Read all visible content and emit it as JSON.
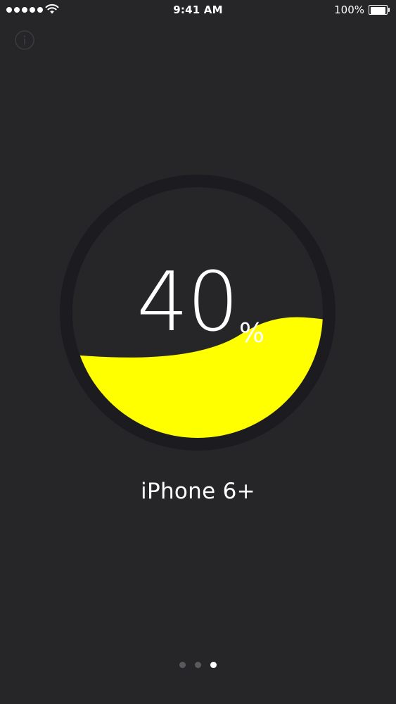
{
  "status_bar": {
    "time": "9:41 AM",
    "battery_percent": "100%",
    "battery_level_fraction": 1.0,
    "signal_bars": 5,
    "signal_icon": "cellular-signal-dots",
    "wifi_icon": "wifi-icon",
    "battery_icon": "battery-icon"
  },
  "info_button": {
    "icon": "info-icon"
  },
  "gauge": {
    "value": "40",
    "unit": "%",
    "fill_fraction": 0.4,
    "fill_color": "#FFFF00",
    "ring_color": "#1C1C20",
    "background_color": "#262628"
  },
  "device": {
    "name": "iPhone 6+"
  },
  "pages": {
    "count": 3,
    "active_index": 2
  }
}
